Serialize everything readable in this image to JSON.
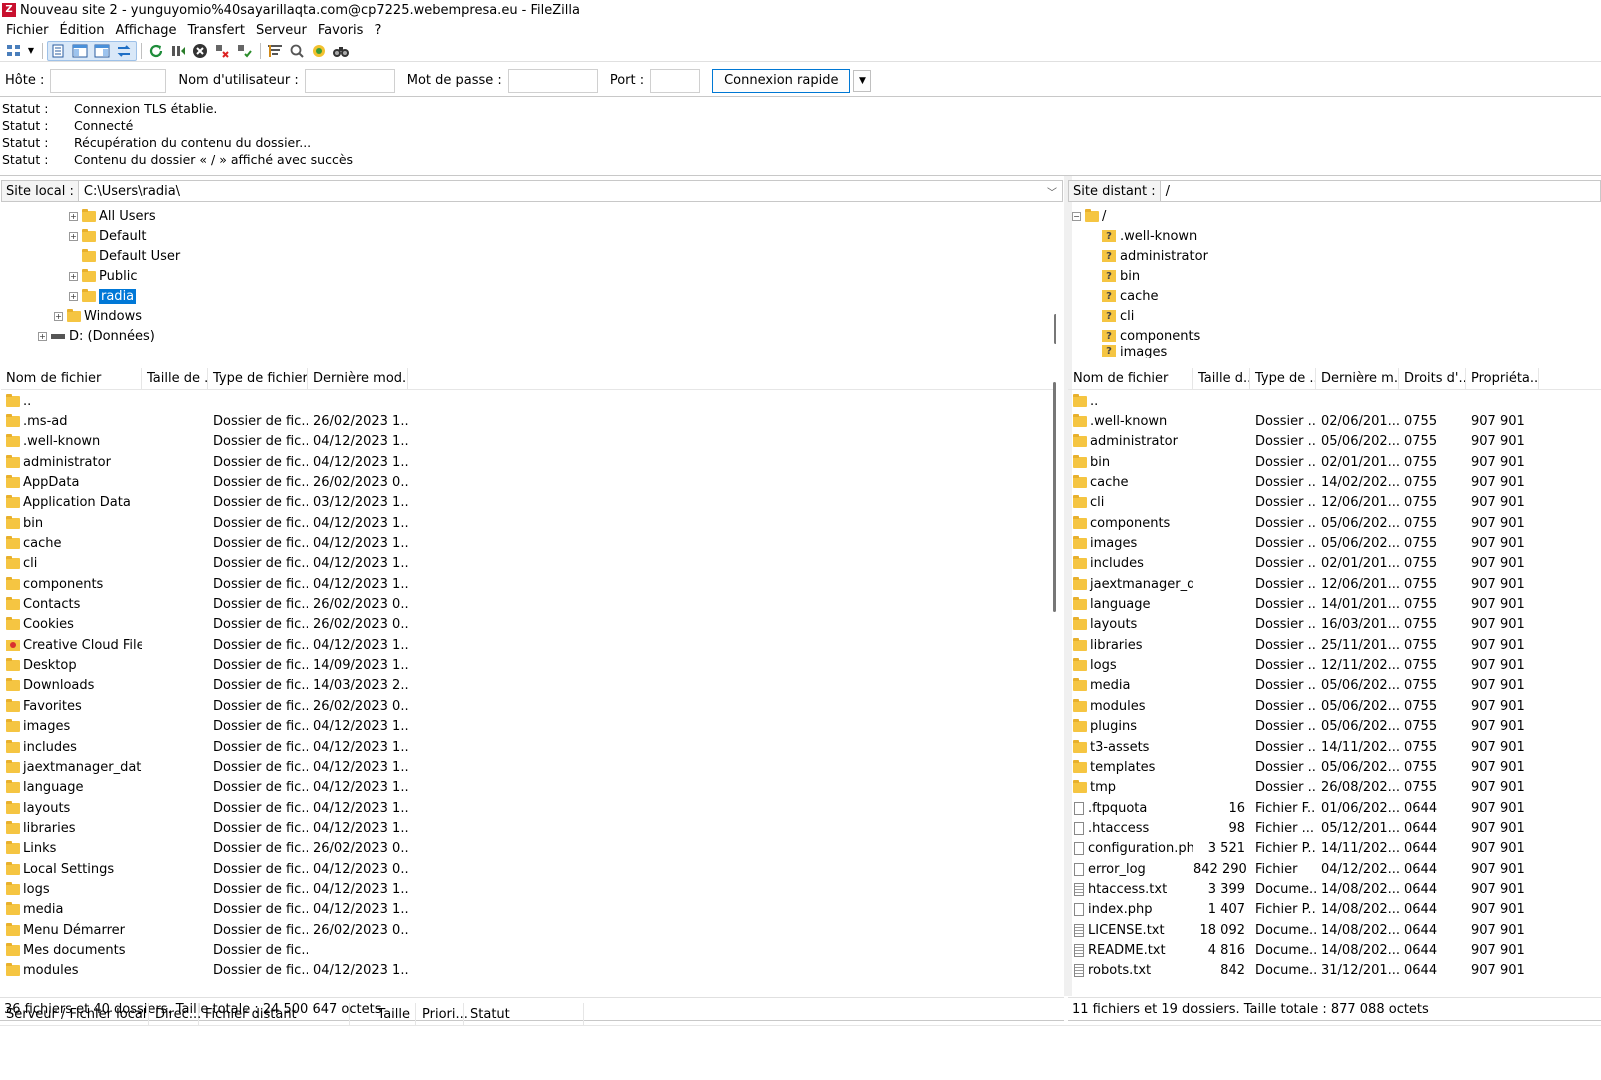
{
  "window": {
    "title": "Nouveau site 2 - yunguyomio%40sayarillaqta.com@cp7225.webempresa.eu - FileZilla",
    "app_icon_letter": "Z"
  },
  "menu": [
    "Fichier",
    "Édition",
    "Affichage",
    "Transfert",
    "Serveur",
    "Favoris",
    "?"
  ],
  "toolbar": {
    "icons": [
      "site-manager-icon",
      "dropdown-arrow-icon",
      "toggle-log-icon",
      "toggle-local-tree-icon",
      "toggle-remote-tree-icon",
      "toggle-queue-icon",
      "refresh-icon",
      "process-queue-icon",
      "cancel-icon",
      "disconnect-icon",
      "reconnect-icon",
      "filter-icon",
      "compare-icon",
      "sync-browse-icon",
      "search-icon"
    ]
  },
  "quickconnect": {
    "host_label": "Hôte :",
    "host_value": "",
    "user_label": "Nom d'utilisateur :",
    "user_value": "",
    "pass_label": "Mot de passe :",
    "pass_value": "",
    "port_label": "Port :",
    "port_value": "",
    "connect_label": "Connexion rapide"
  },
  "log": [
    {
      "key": "Statut :",
      "msg": "Connexion TLS établie."
    },
    {
      "key": "Statut :",
      "msg": "Connecté"
    },
    {
      "key": "Statut :",
      "msg": "Récupération du contenu du dossier..."
    },
    {
      "key": "Statut :",
      "msg": "Contenu du dossier « / » affiché avec succès"
    }
  ],
  "local": {
    "path_label": "Site local :",
    "path_value": "C:\\Users\\radia\\",
    "tree": [
      {
        "label": "All Users",
        "expander": true
      },
      {
        "label": "Default",
        "expander": true
      },
      {
        "label": "Default User",
        "expander": false
      },
      {
        "label": "Public",
        "expander": true
      },
      {
        "label": "radia",
        "expander": true,
        "selected": true
      },
      {
        "label": "Windows",
        "expander": true
      },
      {
        "label": "D: (Données)",
        "expander": true,
        "drive": true
      }
    ],
    "columns": [
      "Nom de fichier",
      "Taille de ...",
      "Type de fichier",
      "Dernière mod..."
    ],
    "files": [
      {
        "name": "..",
        "size": "",
        "type": "",
        "date": ""
      },
      {
        "name": ".ms-ad",
        "size": "",
        "type": "Dossier de fic...",
        "date": "26/02/2023 1..."
      },
      {
        "name": ".well-known",
        "size": "",
        "type": "Dossier de fic...",
        "date": "04/12/2023 1..."
      },
      {
        "name": "administrator",
        "size": "",
        "type": "Dossier de fic...",
        "date": "04/12/2023 1..."
      },
      {
        "name": "AppData",
        "size": "",
        "type": "Dossier de fic...",
        "date": "26/02/2023 0..."
      },
      {
        "name": "Application Data",
        "size": "",
        "type": "Dossier de fic...",
        "date": "03/12/2023 1..."
      },
      {
        "name": "bin",
        "size": "",
        "type": "Dossier de fic...",
        "date": "04/12/2023 1..."
      },
      {
        "name": "cache",
        "size": "",
        "type": "Dossier de fic...",
        "date": "04/12/2023 1..."
      },
      {
        "name": "cli",
        "size": "",
        "type": "Dossier de fic...",
        "date": "04/12/2023 1..."
      },
      {
        "name": "components",
        "size": "",
        "type": "Dossier de fic...",
        "date": "04/12/2023 1..."
      },
      {
        "name": "Contacts",
        "size": "",
        "type": "Dossier de fic...",
        "date": "26/02/2023 0..."
      },
      {
        "name": "Cookies",
        "size": "",
        "type": "Dossier de fic...",
        "date": "26/02/2023 0..."
      },
      {
        "name": "Creative Cloud Files",
        "size": "",
        "type": "Dossier de fic...",
        "date": "04/12/2023 1...",
        "special": true
      },
      {
        "name": "Desktop",
        "size": "",
        "type": "Dossier de fic...",
        "date": "14/09/2023 1..."
      },
      {
        "name": "Downloads",
        "size": "",
        "type": "Dossier de fic...",
        "date": "14/03/2023 2..."
      },
      {
        "name": "Favorites",
        "size": "",
        "type": "Dossier de fic...",
        "date": "26/02/2023 0..."
      },
      {
        "name": "images",
        "size": "",
        "type": "Dossier de fic...",
        "date": "04/12/2023 1..."
      },
      {
        "name": "includes",
        "size": "",
        "type": "Dossier de fic...",
        "date": "04/12/2023 1..."
      },
      {
        "name": "jaextmanager_data",
        "size": "",
        "type": "Dossier de fic...",
        "date": "04/12/2023 1..."
      },
      {
        "name": "language",
        "size": "",
        "type": "Dossier de fic...",
        "date": "04/12/2023 1..."
      },
      {
        "name": "layouts",
        "size": "",
        "type": "Dossier de fic...",
        "date": "04/12/2023 1..."
      },
      {
        "name": "libraries",
        "size": "",
        "type": "Dossier de fic...",
        "date": "04/12/2023 1..."
      },
      {
        "name": "Links",
        "size": "",
        "type": "Dossier de fic...",
        "date": "26/02/2023 0..."
      },
      {
        "name": "Local Settings",
        "size": "",
        "type": "Dossier de fic...",
        "date": "04/12/2023 0..."
      },
      {
        "name": "logs",
        "size": "",
        "type": "Dossier de fic...",
        "date": "04/12/2023 1..."
      },
      {
        "name": "media",
        "size": "",
        "type": "Dossier de fic...",
        "date": "04/12/2023 1..."
      },
      {
        "name": "Menu Démarrer",
        "size": "",
        "type": "Dossier de fic...",
        "date": "26/02/2023 0..."
      },
      {
        "name": "Mes documents",
        "size": "",
        "type": "Dossier de fic...",
        "date": ""
      },
      {
        "name": "modules",
        "size": "",
        "type": "Dossier de fic...",
        "date": "04/12/2023 1..."
      }
    ],
    "status": "36 fichiers et 40 dossiers. Taille totale : 24 500 647 octets"
  },
  "remote": {
    "path_label": "Site distant :",
    "path_value": "/",
    "tree_root": "/",
    "tree": [
      ".well-known",
      "administrator",
      "bin",
      "cache",
      "cli",
      "components",
      "images"
    ],
    "columns": [
      "Nom de fichier",
      "Taille d...",
      "Type de ...",
      "Dernière m...",
      "Droits d'...",
      "Propriéta..."
    ],
    "files": [
      {
        "name": "..",
        "size": "",
        "type": "",
        "date": "",
        "perms": "",
        "owner": "",
        "kind": "folder"
      },
      {
        "name": ".well-known",
        "size": "",
        "type": "Dossier ...",
        "date": "02/06/201...",
        "perms": "0755",
        "owner": "907 901",
        "kind": "folder"
      },
      {
        "name": "administrator",
        "size": "",
        "type": "Dossier ...",
        "date": "05/06/202...",
        "perms": "0755",
        "owner": "907 901",
        "kind": "folder"
      },
      {
        "name": "bin",
        "size": "",
        "type": "Dossier ...",
        "date": "02/01/201...",
        "perms": "0755",
        "owner": "907 901",
        "kind": "folder"
      },
      {
        "name": "cache",
        "size": "",
        "type": "Dossier ...",
        "date": "14/02/202...",
        "perms": "0755",
        "owner": "907 901",
        "kind": "folder"
      },
      {
        "name": "cli",
        "size": "",
        "type": "Dossier ...",
        "date": "12/06/201...",
        "perms": "0755",
        "owner": "907 901",
        "kind": "folder"
      },
      {
        "name": "components",
        "size": "",
        "type": "Dossier ...",
        "date": "05/06/202...",
        "perms": "0755",
        "owner": "907 901",
        "kind": "folder"
      },
      {
        "name": "images",
        "size": "",
        "type": "Dossier ...",
        "date": "05/06/202...",
        "perms": "0755",
        "owner": "907 901",
        "kind": "folder"
      },
      {
        "name": "includes",
        "size": "",
        "type": "Dossier ...",
        "date": "02/01/201...",
        "perms": "0755",
        "owner": "907 901",
        "kind": "folder"
      },
      {
        "name": "jaextmanager_d...",
        "size": "",
        "type": "Dossier ...",
        "date": "12/06/201...",
        "perms": "0755",
        "owner": "907 901",
        "kind": "folder"
      },
      {
        "name": "language",
        "size": "",
        "type": "Dossier ...",
        "date": "14/01/201...",
        "perms": "0755",
        "owner": "907 901",
        "kind": "folder"
      },
      {
        "name": "layouts",
        "size": "",
        "type": "Dossier ...",
        "date": "16/03/201...",
        "perms": "0755",
        "owner": "907 901",
        "kind": "folder"
      },
      {
        "name": "libraries",
        "size": "",
        "type": "Dossier ...",
        "date": "25/11/201...",
        "perms": "0755",
        "owner": "907 901",
        "kind": "folder"
      },
      {
        "name": "logs",
        "size": "",
        "type": "Dossier ...",
        "date": "12/11/202...",
        "perms": "0755",
        "owner": "907 901",
        "kind": "folder"
      },
      {
        "name": "media",
        "size": "",
        "type": "Dossier ...",
        "date": "05/06/202...",
        "perms": "0755",
        "owner": "907 901",
        "kind": "folder"
      },
      {
        "name": "modules",
        "size": "",
        "type": "Dossier ...",
        "date": "05/06/202...",
        "perms": "0755",
        "owner": "907 901",
        "kind": "folder"
      },
      {
        "name": "plugins",
        "size": "",
        "type": "Dossier ...",
        "date": "05/06/202...",
        "perms": "0755",
        "owner": "907 901",
        "kind": "folder"
      },
      {
        "name": "t3-assets",
        "size": "",
        "type": "Dossier ...",
        "date": "14/11/202...",
        "perms": "0755",
        "owner": "907 901",
        "kind": "folder"
      },
      {
        "name": "templates",
        "size": "",
        "type": "Dossier ...",
        "date": "05/06/202...",
        "perms": "0755",
        "owner": "907 901",
        "kind": "folder"
      },
      {
        "name": "tmp",
        "size": "",
        "type": "Dossier ...",
        "date": "26/08/202...",
        "perms": "0755",
        "owner": "907 901",
        "kind": "folder"
      },
      {
        "name": ".ftpquota",
        "size": "16",
        "type": "Fichier F...",
        "date": "01/06/202...",
        "perms": "0644",
        "owner": "907 901",
        "kind": "file"
      },
      {
        "name": ".htaccess",
        "size": "98",
        "type": "Fichier ...",
        "date": "05/12/201...",
        "perms": "0644",
        "owner": "907 901",
        "kind": "file"
      },
      {
        "name": "configuration.php",
        "size": "3 521",
        "type": "Fichier P...",
        "date": "14/11/202...",
        "perms": "0644",
        "owner": "907 901",
        "kind": "file"
      },
      {
        "name": "error_log",
        "size": "842 290",
        "type": "Fichier",
        "date": "04/12/202...",
        "perms": "0644",
        "owner": "907 901",
        "kind": "file"
      },
      {
        "name": "htaccess.txt",
        "size": "3 399",
        "type": "Docume...",
        "date": "14/08/202...",
        "perms": "0644",
        "owner": "907 901",
        "kind": "doc"
      },
      {
        "name": "index.php",
        "size": "1 407",
        "type": "Fichier P...",
        "date": "14/08/202...",
        "perms": "0644",
        "owner": "907 901",
        "kind": "file"
      },
      {
        "name": "LICENSE.txt",
        "size": "18 092",
        "type": "Docume...",
        "date": "14/08/202...",
        "perms": "0644",
        "owner": "907 901",
        "kind": "doc"
      },
      {
        "name": "README.txt",
        "size": "4 816",
        "type": "Docume...",
        "date": "14/08/202...",
        "perms": "0644",
        "owner": "907 901",
        "kind": "doc"
      },
      {
        "name": "robots.txt",
        "size": "842",
        "type": "Docume...",
        "date": "31/12/201...",
        "perms": "0644",
        "owner": "907 901",
        "kind": "doc"
      }
    ],
    "status": "11 fichiers et 19 dossiers. Taille totale : 877 088 octets"
  },
  "queue": {
    "columns": [
      "Serveur / Fichier local",
      "Direc...",
      "Fichier distant",
      "Taille",
      "Priori...",
      "Statut"
    ]
  },
  "colors": {
    "selection": "#0078d7",
    "folder": "#f5c542",
    "accent_border": "#0078d4"
  }
}
